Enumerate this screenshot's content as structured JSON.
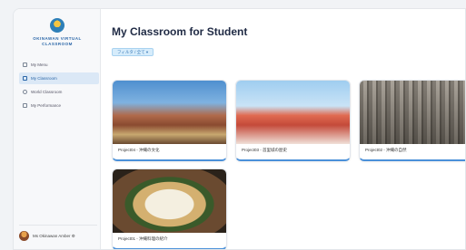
{
  "logo": {
    "text": "OKINAWAN VIRTUAL CLASSROOM"
  },
  "sidebar": {
    "items": [
      {
        "label": "My Menu",
        "active": false,
        "icon": "home-icon"
      },
      {
        "label": "My Classroom",
        "active": true,
        "icon": "classroom-icon"
      },
      {
        "label": "World Classroom",
        "active": false,
        "icon": "globe-icon"
      },
      {
        "label": "My Performance",
        "active": false,
        "icon": "chart-icon"
      }
    ],
    "user": {
      "name": "Ms Okinawan Amber ⚙"
    }
  },
  "main": {
    "title": "My Classroom for Student",
    "filter": "フィルタ / 全て ▾",
    "projects": [
      {
        "label": "Project04 - 沖縄の文化",
        "image": "castle"
      },
      {
        "label": "Project03 - 首里城の歴史",
        "image": "roof"
      },
      {
        "label": "Project02 - 沖縄の自然",
        "image": "stones"
      },
      {
        "label": "Project01 - 沖縄料理の紹介",
        "image": "soba"
      }
    ]
  }
}
